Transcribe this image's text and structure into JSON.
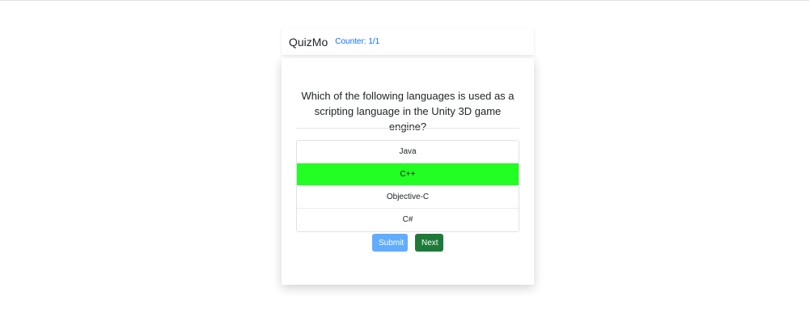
{
  "navbar": {
    "brand": "QuizMo",
    "counter": "Counter: 1/1"
  },
  "question": {
    "text": "Which of the following languages is used as a scripting language in the Unity 3D game engine?"
  },
  "options": [
    {
      "label": "Java",
      "selected": false
    },
    {
      "label": "C++",
      "selected": true
    },
    {
      "label": "Objective-C",
      "selected": false
    },
    {
      "label": "C#",
      "selected": false
    }
  ],
  "buttons": {
    "submit": "Submit",
    "next": "Next"
  },
  "colors": {
    "selected_option": "#22ff22",
    "submit_button": "#61acff",
    "next_button": "#1f7a3a",
    "counter_text": "#0d6efd"
  }
}
